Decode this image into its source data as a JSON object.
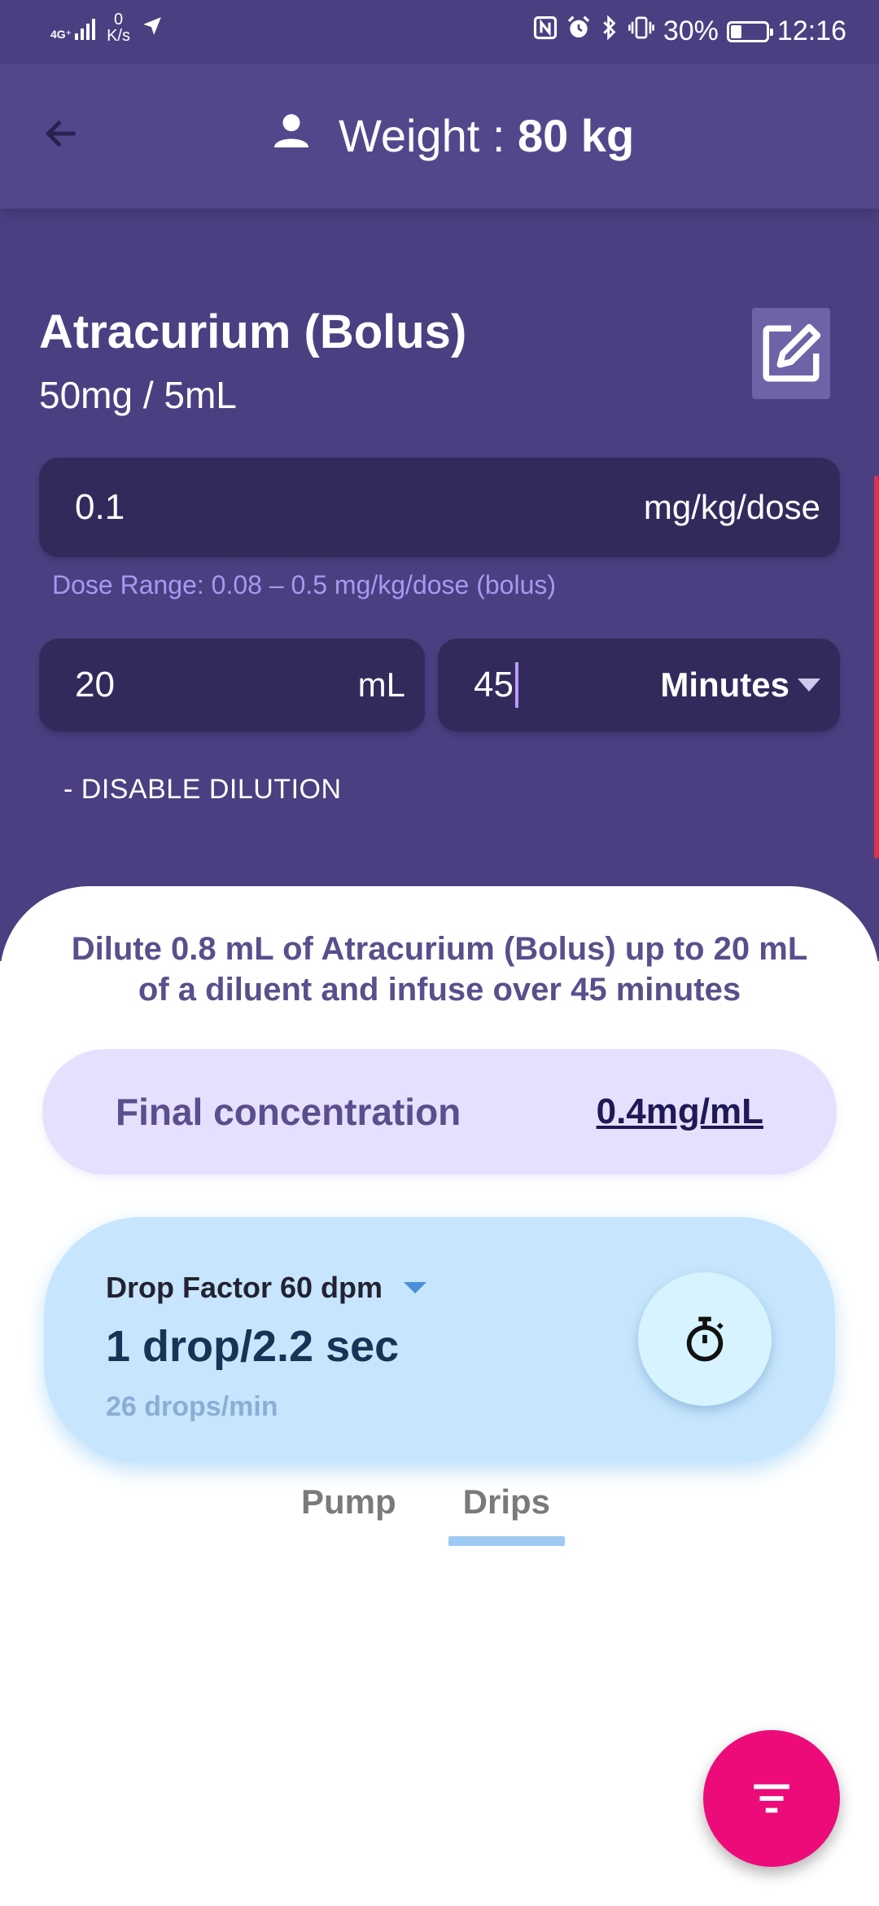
{
  "status_bar": {
    "network": "4G⁺",
    "speed_value": "0",
    "speed_unit": "K/s",
    "battery_percent": "30%",
    "battery_level": 0.3,
    "time": "12:16",
    "icons": [
      "nfc-icon",
      "alarm-icon",
      "bluetooth-icon",
      "vibrate-icon"
    ]
  },
  "appbar": {
    "title_prefix": "Weight : ",
    "title_value": "80 kg"
  },
  "drug": {
    "name": "Atracurium (Bolus)",
    "concentration": "50mg / 5mL"
  },
  "dose": {
    "value": "0.1",
    "unit": "mg/kg/dose",
    "range": "Dose Range: 0.08 – 0.5 mg/kg/dose (bolus)"
  },
  "dilution": {
    "volume_value": "20",
    "volume_unit": "mL",
    "time_value": "45",
    "time_unit": "Minutes",
    "disable_label": "- DISABLE DILUTION"
  },
  "result": {
    "instruction": "Dilute 0.8 mL of Atracurium (Bolus) up to 20 mL of a diluent and infuse over 45 minutes",
    "final_concentration_label": "Final concentration",
    "final_concentration_value": "0.4mg/mL"
  },
  "drip": {
    "drop_factor": "Drop Factor 60 dpm",
    "rate": "1 drop/2.2 sec",
    "drops_per_min": "26 drops/min"
  },
  "tabs": [
    {
      "label": "Pump",
      "active": false
    },
    {
      "label": "Drips",
      "active": true
    }
  ],
  "colors": {
    "primary": "#4b3f82",
    "field": "#332a5c",
    "accent_fab": "#ec0b78",
    "drip_card": "#c7e6fd",
    "final_conc_pill": "#e6e0fe"
  }
}
